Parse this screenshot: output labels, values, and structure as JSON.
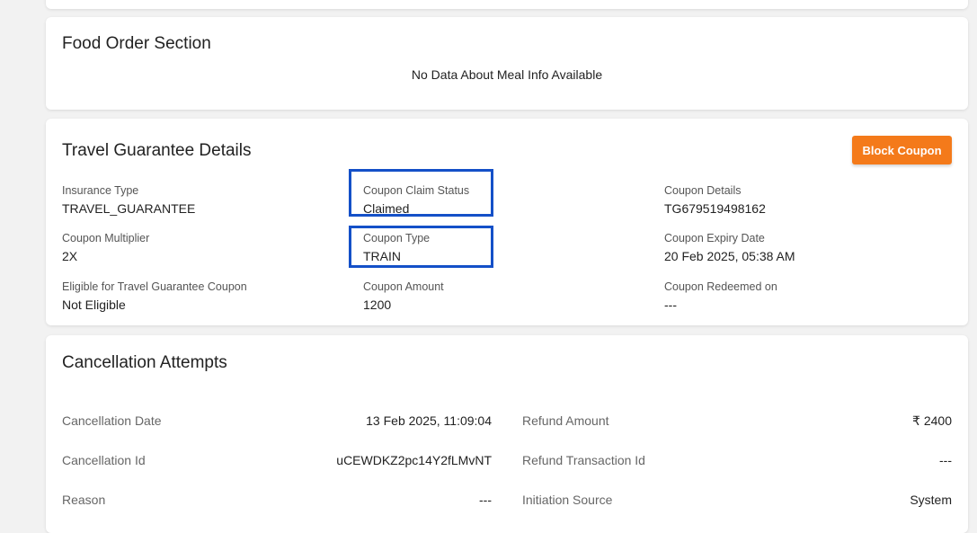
{
  "food_section": {
    "title": "Food Order Section",
    "empty_message": "No Data About Meal Info Available"
  },
  "travel_guarantee": {
    "title": "Travel Guarantee Details",
    "block_button_label": "Block Coupon",
    "accent_color": "#f47a1a",
    "highlight_color": "#1450c8",
    "fields": {
      "insurance_type": {
        "label": "Insurance Type",
        "value": "TRAVEL_GUARANTEE"
      },
      "coupon_claim_status": {
        "label": "Coupon Claim Status",
        "value": "Claimed"
      },
      "coupon_details": {
        "label": "Coupon Details",
        "value": "TG679519498162"
      },
      "coupon_multiplier": {
        "label": "Coupon Multiplier",
        "value": "2X"
      },
      "coupon_type": {
        "label": "Coupon Type",
        "value": "TRAIN"
      },
      "coupon_expiry_date": {
        "label": "Coupon Expiry Date",
        "value": "20 Feb 2025, 05:38 AM"
      },
      "eligible_tg_coupon": {
        "label": "Eligible for Travel Guarantee Coupon",
        "value": "Not Eligible"
      },
      "coupon_amount": {
        "label": "Coupon Amount",
        "value": "1200"
      },
      "coupon_redeemed_on": {
        "label": "Coupon Redeemed on",
        "value": "---"
      }
    }
  },
  "cancellation": {
    "title": "Cancellation Attempts",
    "rows": [
      {
        "left_label": "Cancellation Date",
        "left_value": "13 Feb 2025, 11:09:04",
        "right_label": "Refund Amount",
        "right_value": "₹ 2400"
      },
      {
        "left_label": "Cancellation Id",
        "left_value": "uCEWDKZ2pc14Y2fLMvNT",
        "right_label": "Refund Transaction Id",
        "right_value": "---"
      },
      {
        "left_label": "Reason",
        "left_value": "---",
        "right_label": "Initiation Source",
        "right_value": "System"
      }
    ]
  }
}
